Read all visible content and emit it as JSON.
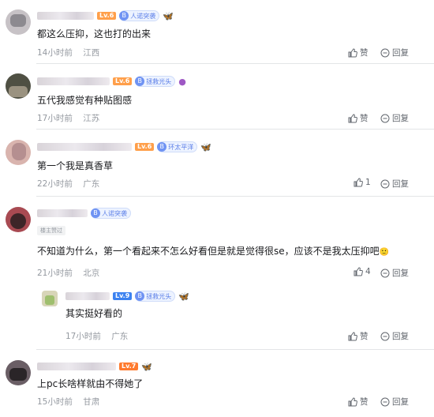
{
  "comments": [
    {
      "level": "Lv.6",
      "fan_badge": "人诺突袭",
      "text": "都这么压抑，这也打的出来",
      "time": "14小时前",
      "location": "江西",
      "like_label": "赞",
      "reply_label": "回复"
    },
    {
      "level": "Lv.6",
      "fan_badge": "拯救光头",
      "text": "五代我感觉有种贴图感",
      "time": "17小时前",
      "location": "江苏",
      "like_label": "赞",
      "reply_label": "回复"
    },
    {
      "level": "Lv.6",
      "fan_badge": "环太平洋",
      "text": "第一个我是真香草",
      "time": "22小时前",
      "location": "广东",
      "like_count": "1",
      "reply_label": "回复"
    },
    {
      "fan_badge": "人诺突袭",
      "up_badge": "楼主赞过",
      "text": "不知道为什么，第一个看起来不怎么好看但是就是觉得很se，应该不是我太压抑吧",
      "emoji": "🙂",
      "time": "21小时前",
      "location": "北京",
      "like_count": "4",
      "reply_label": "回复",
      "reply": {
        "level": "Lv.9",
        "fan_badge": "拯救光头",
        "text": "其实挺好看的",
        "time": "17小时前",
        "location": "广东",
        "like_label": "赞",
        "reply_label": "回复"
      }
    },
    {
      "level": "Lv.7",
      "text": "上pc长啥样就由不得她了",
      "time": "15小时前",
      "location": "甘肃",
      "like_label": "赞",
      "reply_label": "回复"
    }
  ],
  "colors": {
    "lv6": "#ff9f4a",
    "lv7": "#ff7a2e",
    "lv9": "#3c82f0",
    "fan_blue": "#6f93f3",
    "meta_gray": "#9499a0"
  },
  "icons": {
    "like": "thumb-up-icon",
    "reply": "reply-bubble-icon",
    "fan": "fan-medal-icon"
  }
}
